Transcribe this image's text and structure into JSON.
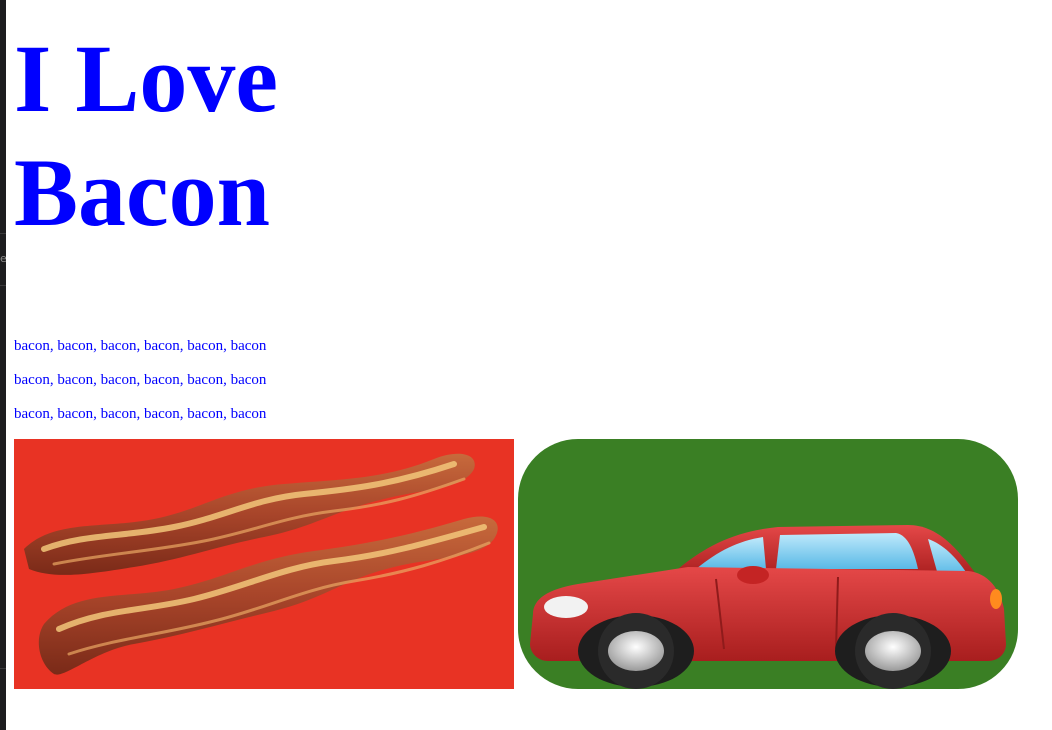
{
  "page": {
    "title_line1": "I Love",
    "title_line2": "Bacon",
    "lines": [
      "bacon, bacon, bacon, bacon, bacon, bacon",
      "bacon, bacon, bacon, bacon, bacon, bacon",
      "bacon, bacon, bacon, bacon, bacon, bacon"
    ],
    "text_color": "#0000ff"
  },
  "images": [
    {
      "name": "bacon-image",
      "background": "#e83324"
    },
    {
      "name": "car-image",
      "background": "#3a7f24"
    }
  ],
  "gutter": {
    "label": "e"
  }
}
